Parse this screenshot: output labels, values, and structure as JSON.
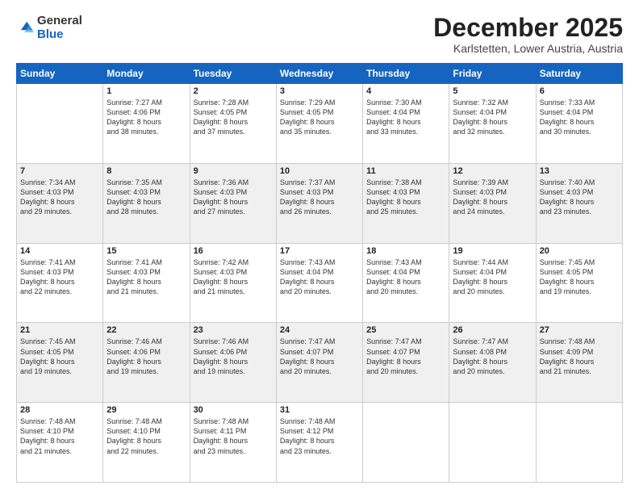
{
  "logo": {
    "general": "General",
    "blue": "Blue"
  },
  "header": {
    "month": "December 2025",
    "location": "Karlstetten, Lower Austria, Austria"
  },
  "weekdays": [
    "Sunday",
    "Monday",
    "Tuesday",
    "Wednesday",
    "Thursday",
    "Friday",
    "Saturday"
  ],
  "weeks": [
    [
      {
        "day": "",
        "info": ""
      },
      {
        "day": "1",
        "info": "Sunrise: 7:27 AM\nSunset: 4:06 PM\nDaylight: 8 hours\nand 38 minutes."
      },
      {
        "day": "2",
        "info": "Sunrise: 7:28 AM\nSunset: 4:05 PM\nDaylight: 8 hours\nand 37 minutes."
      },
      {
        "day": "3",
        "info": "Sunrise: 7:29 AM\nSunset: 4:05 PM\nDaylight: 8 hours\nand 35 minutes."
      },
      {
        "day": "4",
        "info": "Sunrise: 7:30 AM\nSunset: 4:04 PM\nDaylight: 8 hours\nand 33 minutes."
      },
      {
        "day": "5",
        "info": "Sunrise: 7:32 AM\nSunset: 4:04 PM\nDaylight: 8 hours\nand 32 minutes."
      },
      {
        "day": "6",
        "info": "Sunrise: 7:33 AM\nSunset: 4:04 PM\nDaylight: 8 hours\nand 30 minutes."
      }
    ],
    [
      {
        "day": "7",
        "info": "Sunrise: 7:34 AM\nSunset: 4:03 PM\nDaylight: 8 hours\nand 29 minutes."
      },
      {
        "day": "8",
        "info": "Sunrise: 7:35 AM\nSunset: 4:03 PM\nDaylight: 8 hours\nand 28 minutes."
      },
      {
        "day": "9",
        "info": "Sunrise: 7:36 AM\nSunset: 4:03 PM\nDaylight: 8 hours\nand 27 minutes."
      },
      {
        "day": "10",
        "info": "Sunrise: 7:37 AM\nSunset: 4:03 PM\nDaylight: 8 hours\nand 26 minutes."
      },
      {
        "day": "11",
        "info": "Sunrise: 7:38 AM\nSunset: 4:03 PM\nDaylight: 8 hours\nand 25 minutes."
      },
      {
        "day": "12",
        "info": "Sunrise: 7:39 AM\nSunset: 4:03 PM\nDaylight: 8 hours\nand 24 minutes."
      },
      {
        "day": "13",
        "info": "Sunrise: 7:40 AM\nSunset: 4:03 PM\nDaylight: 8 hours\nand 23 minutes."
      }
    ],
    [
      {
        "day": "14",
        "info": "Sunrise: 7:41 AM\nSunset: 4:03 PM\nDaylight: 8 hours\nand 22 minutes."
      },
      {
        "day": "15",
        "info": "Sunrise: 7:41 AM\nSunset: 4:03 PM\nDaylight: 8 hours\nand 21 minutes."
      },
      {
        "day": "16",
        "info": "Sunrise: 7:42 AM\nSunset: 4:03 PM\nDaylight: 8 hours\nand 21 minutes."
      },
      {
        "day": "17",
        "info": "Sunrise: 7:43 AM\nSunset: 4:04 PM\nDaylight: 8 hours\nand 20 minutes."
      },
      {
        "day": "18",
        "info": "Sunrise: 7:43 AM\nSunset: 4:04 PM\nDaylight: 8 hours\nand 20 minutes."
      },
      {
        "day": "19",
        "info": "Sunrise: 7:44 AM\nSunset: 4:04 PM\nDaylight: 8 hours\nand 20 minutes."
      },
      {
        "day": "20",
        "info": "Sunrise: 7:45 AM\nSunset: 4:05 PM\nDaylight: 8 hours\nand 19 minutes."
      }
    ],
    [
      {
        "day": "21",
        "info": "Sunrise: 7:45 AM\nSunset: 4:05 PM\nDaylight: 8 hours\nand 19 minutes."
      },
      {
        "day": "22",
        "info": "Sunrise: 7:46 AM\nSunset: 4:06 PM\nDaylight: 8 hours\nand 19 minutes."
      },
      {
        "day": "23",
        "info": "Sunrise: 7:46 AM\nSunset: 4:06 PM\nDaylight: 8 hours\nand 19 minutes."
      },
      {
        "day": "24",
        "info": "Sunrise: 7:47 AM\nSunset: 4:07 PM\nDaylight: 8 hours\nand 20 minutes."
      },
      {
        "day": "25",
        "info": "Sunrise: 7:47 AM\nSunset: 4:07 PM\nDaylight: 8 hours\nand 20 minutes."
      },
      {
        "day": "26",
        "info": "Sunrise: 7:47 AM\nSunset: 4:08 PM\nDaylight: 8 hours\nand 20 minutes."
      },
      {
        "day": "27",
        "info": "Sunrise: 7:48 AM\nSunset: 4:09 PM\nDaylight: 8 hours\nand 21 minutes."
      }
    ],
    [
      {
        "day": "28",
        "info": "Sunrise: 7:48 AM\nSunset: 4:10 PM\nDaylight: 8 hours\nand 21 minutes."
      },
      {
        "day": "29",
        "info": "Sunrise: 7:48 AM\nSunset: 4:10 PM\nDaylight: 8 hours\nand 22 minutes."
      },
      {
        "day": "30",
        "info": "Sunrise: 7:48 AM\nSunset: 4:11 PM\nDaylight: 8 hours\nand 23 minutes."
      },
      {
        "day": "31",
        "info": "Sunrise: 7:48 AM\nSunset: 4:12 PM\nDaylight: 8 hours\nand 23 minutes."
      },
      {
        "day": "",
        "info": ""
      },
      {
        "day": "",
        "info": ""
      },
      {
        "day": "",
        "info": ""
      }
    ]
  ]
}
